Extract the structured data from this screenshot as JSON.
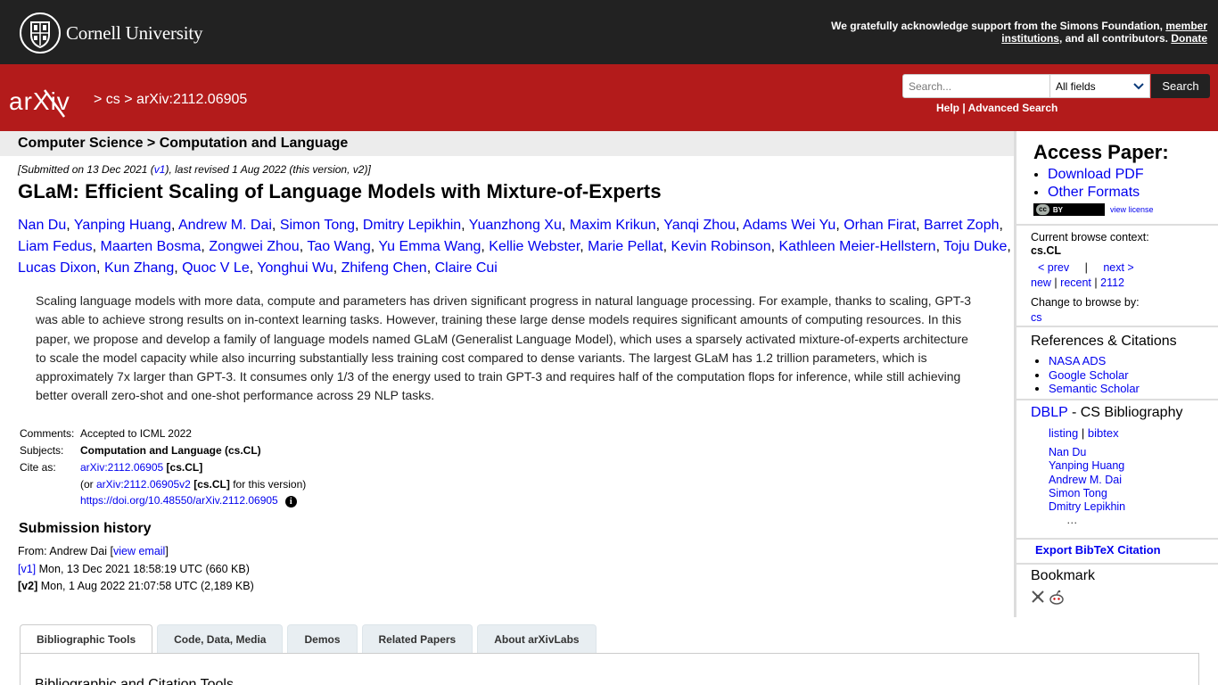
{
  "topbar": {
    "university": "Cornell University",
    "support_line1": "We gratefully acknowledge support from the Simons Foundation,",
    "member_link": "member",
    "institutions_link": "institutions",
    "support_line2": ", and all contributors.",
    "donate_link": "Donate"
  },
  "header": {
    "logo_text": "arXiv",
    "sep1": ">",
    "crumb_cs": "cs",
    "sep2": ">",
    "crumb_id": "arXiv:2112.06905",
    "search_placeholder": "Search...",
    "fields_selected": "All fields",
    "search_button": "Search",
    "help_link": "Help",
    "help_sep": "|",
    "advanced_link": "Advanced Search"
  },
  "subheader": {
    "subject": "Computer Science > Computation and Language"
  },
  "paper": {
    "submitted_prefix": "[Submitted on 13 Dec 2021 (",
    "submitted_v1": "v1",
    "submitted_suffix": "), last revised 1 Aug 2022 (this version, v2)]",
    "title": "GLaM: Efficient Scaling of Language Models with Mixture-of-Experts",
    "authors": [
      "Nan Du",
      "Yanping Huang",
      "Andrew M. Dai",
      "Simon Tong",
      "Dmitry Lepikhin",
      "Yuanzhong Xu",
      "Maxim Krikun",
      "Yanqi Zhou",
      "Adams Wei Yu",
      "Orhan Firat",
      "Barret Zoph",
      "Liam Fedus",
      "Maarten Bosma",
      "Zongwei Zhou",
      "Tao Wang",
      "Yu Emma Wang",
      "Kellie Webster",
      "Marie Pellat",
      "Kevin Robinson",
      "Kathleen Meier-Hellstern",
      "Toju Duke",
      "Lucas Dixon",
      "Kun Zhang",
      "Quoc V Le",
      "Yonghui Wu",
      "Zhifeng Chen",
      "Claire Cui"
    ],
    "abstract": "Scaling language models with more data, compute and parameters has driven significant progress in natural language processing. For example, thanks to scaling, GPT-3 was able to achieve strong results on in-context learning tasks. However, training these large dense models requires significant amounts of computing resources. In this paper, we propose and develop a family of language models named GLaM (Generalist Language Model), which uses a sparsely activated mixture-of-experts architecture to scale the model capacity while also incurring substantially less training cost compared to dense variants. The largest GLaM has 1.2 trillion parameters, which is approximately 7x larger than GPT-3. It consumes only 1/3 of the energy used to train GPT-3 and requires half of the computation flops for inference, while still achieving better overall zero-shot and one-shot performance across 29 NLP tasks."
  },
  "meta": {
    "comments_label": "Comments:",
    "comments": "Accepted to ICML 2022",
    "subjects_label": "Subjects:",
    "subjects": "Computation and Language (cs.CL)",
    "cite_label": "Cite as:",
    "cite_id": "arXiv:2112.06905",
    "cite_cat": "[cs.CL]",
    "or_prefix": "(or ",
    "cite_v2": "arXiv:2112.06905v2",
    "cite_v2_cat": "[cs.CL]",
    "or_suffix": "for this version)",
    "doi": "https://doi.org/10.48550/arXiv.2112.06905",
    "info_icon": "i"
  },
  "history": {
    "title": "Submission history",
    "from_prefix": "From: Andrew Dai [",
    "view_email": "view email",
    "from_suffix": "]",
    "v1_label": "[v1]",
    "v1_text": "Mon, 13 Dec 2021 18:58:19 UTC (660 KB)",
    "v2_label": "[v2]",
    "v2_text": "Mon, 1 Aug 2022 21:07:58 UTC (2,189 KB)"
  },
  "tabs": [
    {
      "label": "Bibliographic Tools",
      "active": true
    },
    {
      "label": "Code, Data, Media",
      "active": false
    },
    {
      "label": "Demos",
      "active": false
    },
    {
      "label": "Related Papers",
      "active": false
    },
    {
      "label": "About arXivLabs",
      "active": false
    }
  ],
  "tab_panel_title": "Bibliographic and Citation Tools",
  "sidebar": {
    "access_title": "Access Paper:",
    "download_pdf": "Download PDF",
    "other_formats": "Other Formats",
    "cc_label": "cc",
    "by_label": "BY",
    "view_license": "view license",
    "context_label": "Current browse context:",
    "context_value": "cs.CL",
    "prev": "< prev",
    "pipe": "|",
    "next": "next >",
    "new": "new",
    "recent": "recent",
    "yearmonth": "2112",
    "change_label": "Change to browse by:",
    "change_cs": "cs",
    "refs_title": "References & Citations",
    "refs": [
      "NASA ADS",
      "Google Scholar",
      "Semantic Scholar"
    ],
    "dblp_link": "DBLP",
    "dblp_rest": " - CS Bibliography",
    "listing": "listing",
    "bibtex": "bibtex",
    "dblp_authors": [
      "Nan Du",
      "Yanping Huang",
      "Andrew M. Dai",
      "Simon Tong",
      "Dmitry Lepikhin"
    ],
    "ellipsis": "…",
    "export_bibtex": "Export BibTeX Citation",
    "bookmark_title": "Bookmark"
  },
  "colors": {
    "red": "#b31b1b",
    "dark": "#222222",
    "link": "#0000ee"
  }
}
